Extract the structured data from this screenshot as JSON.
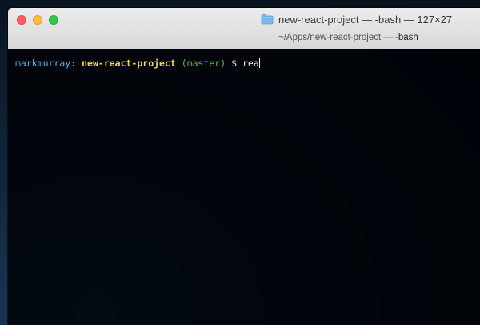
{
  "window": {
    "title": "new-react-project — -bash — 127×27",
    "tab_path": "~/Apps/new-react-project — ",
    "tab_command": "-bash"
  },
  "terminal": {
    "user": "markmurray",
    "separator": ":",
    "directory": "new-react-project",
    "branch": "(master)",
    "prompt_symbol": "$",
    "input": "rea"
  },
  "icons": {
    "folder": "folder-icon",
    "close": "close-icon",
    "minimize": "minimize-icon",
    "maximize": "maximize-icon"
  },
  "colors": {
    "close": "#fc605c",
    "minimize": "#fdbc40",
    "maximize": "#34c84a",
    "user": "#59b5e8",
    "directory": "#f0d848",
    "branch": "#4ec64e",
    "folder": "#7ab8f0"
  }
}
